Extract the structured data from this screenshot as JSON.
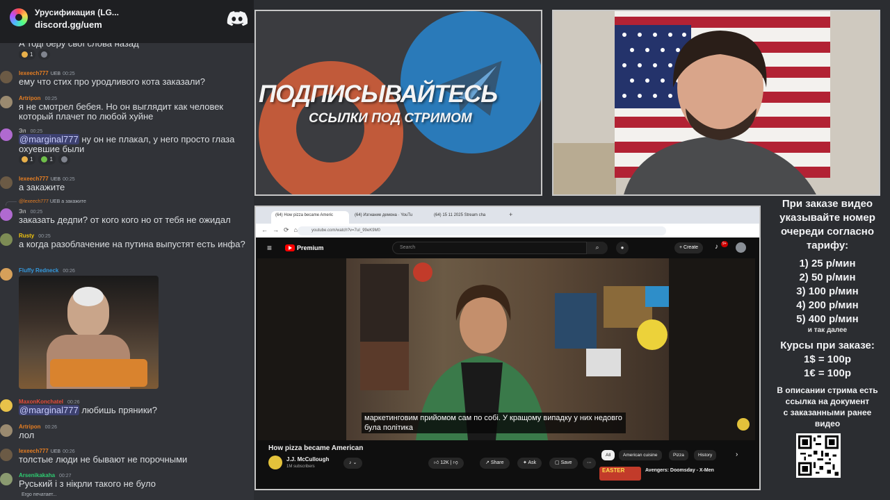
{
  "server": {
    "name": "Урусификация (LG...",
    "link": "discord.gg/uem"
  },
  "chat": {
    "top_partial": "А тоді беру свої слова назад",
    "top_reactions": [
      "1"
    ],
    "messages": [
      {
        "user": "lexeech777",
        "badge": "UEB",
        "time": "00:25",
        "text": "ему что стих про уродливого кота заказали?",
        "color": "#e67e22"
      },
      {
        "user": "Artripon",
        "badge": "",
        "time": "00:25",
        "text": "я не смотрел бебея. Но он выглядит как человек который плачет по любой хуйне",
        "color": "#e67e22"
      },
      {
        "user": "Эл",
        "badge": "",
        "time": "00:25",
        "mention": "@marginal777",
        "text": " ну он не плакал, у него просто глаза охуевшие были",
        "color": "#a8a8a8",
        "reactions": [
          "1",
          "1"
        ]
      },
      {
        "user": "lexeech777",
        "badge": "UEB",
        "time": "00:25",
        "text": "а закажите",
        "color": "#e67e22"
      },
      {
        "reply_user": "@lexeech777",
        "reply_badge": "UEB",
        "reply_text": "а закажите",
        "user": "Эл",
        "badge": "",
        "time": "00:25",
        "text": "заказать дедпи? от кого кого но от тебя не ожидал",
        "color": "#a8a8a8"
      },
      {
        "user": "Rusty",
        "badge": "",
        "time": "00:25",
        "text": "а когда разоблачение на путина выпустят есть инфа?",
        "color": "#f1c40f"
      },
      {
        "user": "Fluffy Redneck",
        "badge": "",
        "time": "00:26",
        "text": "",
        "color": "#3498db"
      },
      {
        "user": "MaxonKonchatel",
        "badge": "",
        "time": "00:26",
        "mention": "@marginal777",
        "text": " любишь пряники?",
        "color": "#e74c3c"
      },
      {
        "user": "Artripon",
        "badge": "",
        "time": "00:26",
        "text": "лол",
        "color": "#e67e22"
      },
      {
        "user": "lexeech777",
        "badge": "UEB",
        "time": "00:26",
        "text": "толстые люди не бывают не порочными",
        "color": "#e67e22"
      },
      {
        "user": "Arsenikakaha",
        "badge": "",
        "time": "00:27",
        "text": "Руський і з нікрли такого не було",
        "color": "#2ecc71"
      }
    ],
    "typing": "Ergo печатает..."
  },
  "promo": {
    "title": "ПОДПИСЫВАЙТЕСЬ",
    "subtitle": "ССЫЛКИ ПОД СТРИМОМ"
  },
  "browser": {
    "tabs": [
      "(64) How pizza became Americ",
      "(64) Изгнание демона · YouTu",
      "(64) 15 11 2025 Stream cha"
    ],
    "url": "youtube.com/watch?v=7uI_99eK9M0",
    "youtube": {
      "logo": "Premium",
      "notifications": "9+",
      "search_placeholder": "Search",
      "create_label": "Create",
      "subtitle_text": "маркетинговим прийомом сам по собі. У кращому випадку у них недовго була політика",
      "video_title": "How pizza became American",
      "channel_name": "J.J. McCullough",
      "channel_subs": "1M subscribers",
      "likes": "12K",
      "share": "Share",
      "ask": "Ask",
      "save": "Save",
      "chips": [
        "All",
        "American cuisine",
        "Pizza",
        "History"
      ],
      "rec_thumb_text": "EASTER",
      "rec_title": "Avengers: Doomsday - X-Men"
    }
  },
  "pricing": {
    "heading": [
      "При заказе видео",
      "указывайте номер",
      "очереди согласно",
      "тарифу:"
    ],
    "tiers": [
      "1) 25 р/мин",
      "2) 50 р/мин",
      "3) 100 р/мин",
      "4) 200 р/мин",
      "5) 400 р/мин"
    ],
    "etc": "и так далее",
    "courses_heading": "Курсы при заказе:",
    "courses": [
      "1$ = 100р",
      "1€ = 100р"
    ],
    "description": [
      "В описании стрима есть",
      "ссылка на документ",
      "с заказанными ранее",
      "видео"
    ]
  }
}
